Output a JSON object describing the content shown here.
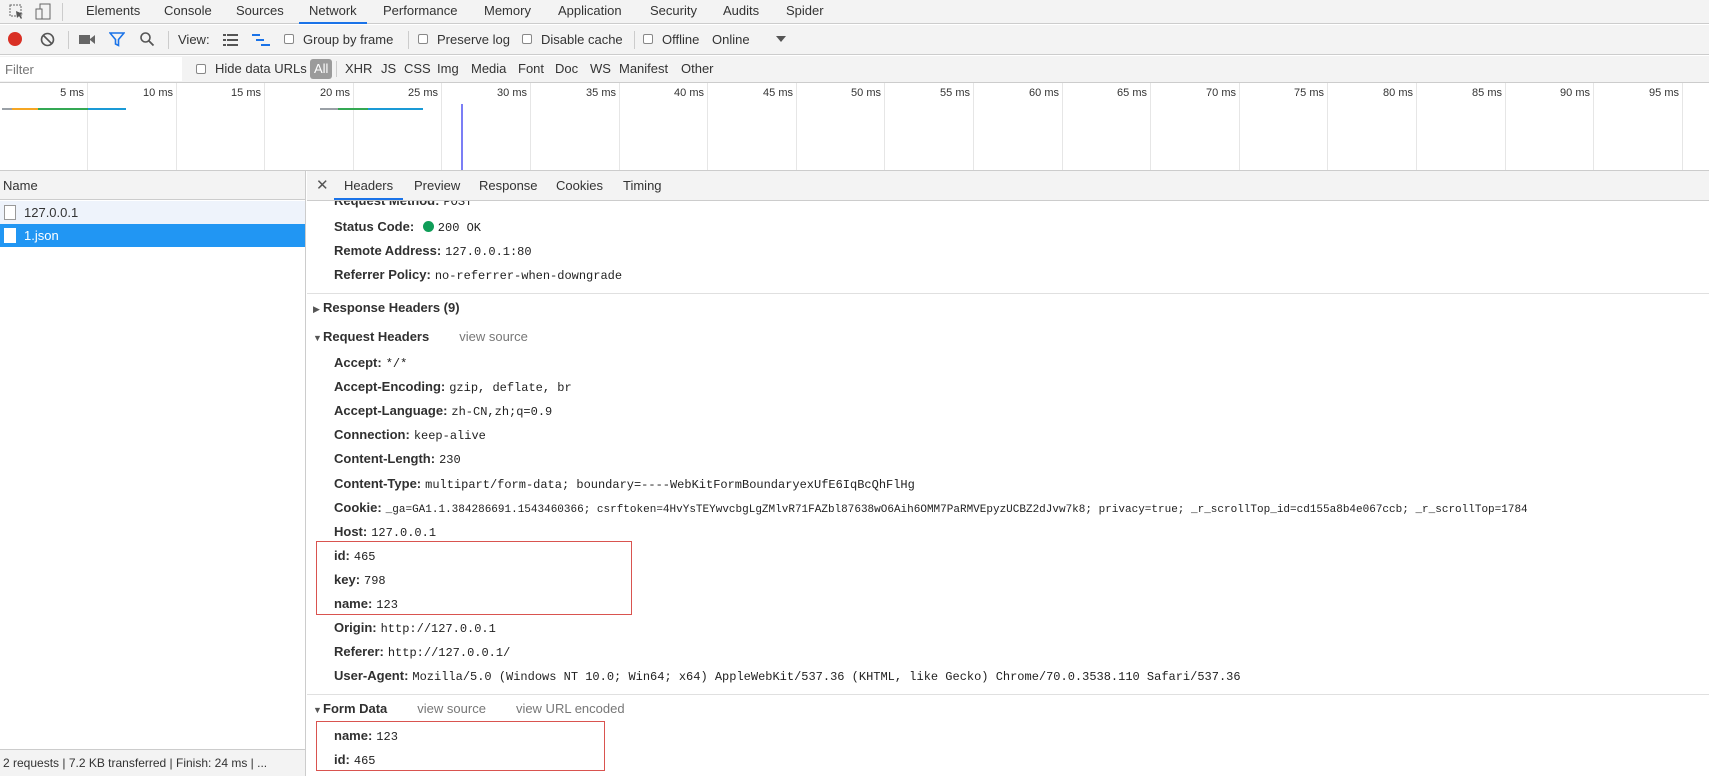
{
  "tabs": [
    "Elements",
    "Console",
    "Sources",
    "Network",
    "Performance",
    "Memory",
    "Application",
    "Security",
    "Audits",
    "Spider"
  ],
  "selected_tab": "Network",
  "toolbar": {
    "view_label": "View:",
    "group_by_frame": "Group by frame",
    "preserve_log": "Preserve log",
    "disable_cache": "Disable cache",
    "offline": "Offline",
    "throttle": "Online"
  },
  "filter": {
    "placeholder": "Filter",
    "hide_data_urls": "Hide data URLs",
    "types": [
      "All",
      "XHR",
      "JS",
      "CSS",
      "Img",
      "Media",
      "Font",
      "Doc",
      "WS",
      "Manifest",
      "Other"
    ]
  },
  "timeline": {
    "ticks": [
      "5 ms",
      "10 ms",
      "15 ms",
      "20 ms",
      "25 ms",
      "30 ms",
      "35 ms",
      "40 ms",
      "45 ms",
      "50 ms",
      "55 ms",
      "60 ms",
      "65 ms",
      "70 ms",
      "75 ms",
      "80 ms",
      "85 ms",
      "90 ms",
      "95 ms"
    ]
  },
  "requests": {
    "header": "Name",
    "items": [
      {
        "name": "127.0.0.1",
        "selected": false
      },
      {
        "name": "1.json",
        "selected": true
      }
    ]
  },
  "status_bar": {
    "text": "2 requests  |  7.2 KB transferred  |  Finish: 24 ms  |  ..."
  },
  "detail_tabs": [
    "Headers",
    "Preview",
    "Response",
    "Cookies",
    "Timing"
  ],
  "selected_detail_tab": "Headers",
  "general": [
    {
      "key": "Request Method:",
      "value": "POST"
    },
    {
      "key": "Status Code:",
      "value": "200 OK"
    },
    {
      "key": "Remote Address:",
      "value": "127.0.0.1:80"
    },
    {
      "key": "Referrer Policy:",
      "value": "no-referrer-when-downgrade"
    }
  ],
  "response_headers": {
    "title": "Response Headers (9)"
  },
  "request_headers": {
    "title": "Request Headers",
    "view_source": "view source",
    "items": [
      {
        "key": "Accept:",
        "value": "*/*"
      },
      {
        "key": "Accept-Encoding:",
        "value": "gzip, deflate, br"
      },
      {
        "key": "Accept-Language:",
        "value": "zh-CN,zh;q=0.9"
      },
      {
        "key": "Connection:",
        "value": "keep-alive"
      },
      {
        "key": "Content-Length:",
        "value": "230"
      },
      {
        "key": "Content-Type:",
        "value": "multipart/form-data; boundary=----WebKitFormBoundaryexUfE6IqBcQhFlHg"
      },
      {
        "key": "Cookie:",
        "value": "_ga=GA1.1.384286691.1543460366; csrftoken=4HvYsTEYwvcbgLgZMlvR71FAZbl87638wO6Aih6OMM7PaRMVEpyzUCBZ2dJvw7k8; privacy=true; _r_scrollTop_id=cd155a8b4e067ccb; _r_scrollTop=1784"
      },
      {
        "key": "Host:",
        "value": "127.0.0.1"
      },
      {
        "key": "id:",
        "value": "465"
      },
      {
        "key": "key:",
        "value": "798"
      },
      {
        "key": "name:",
        "value": "123"
      },
      {
        "key": "Origin:",
        "value": "http://127.0.0.1"
      },
      {
        "key": "Referer:",
        "value": "http://127.0.0.1/"
      },
      {
        "key": "User-Agent:",
        "value": "Mozilla/5.0 (Windows NT 10.0; Win64; x64) AppleWebKit/537.36 (KHTML, like Gecko) Chrome/70.0.3538.110 Safari/537.36"
      }
    ]
  },
  "form_data": {
    "title": "Form Data",
    "view_source": "view source",
    "view_url_encoded": "view URL encoded",
    "items": [
      {
        "key": "name:",
        "value": "123"
      },
      {
        "key": "id:",
        "value": "465"
      }
    ]
  },
  "colors": {
    "accent": "#1a73e8",
    "selected_row": "#2196f3",
    "record": "#d93025",
    "status_ok": "#0f9d58",
    "highlight_box": "#d9534f"
  }
}
